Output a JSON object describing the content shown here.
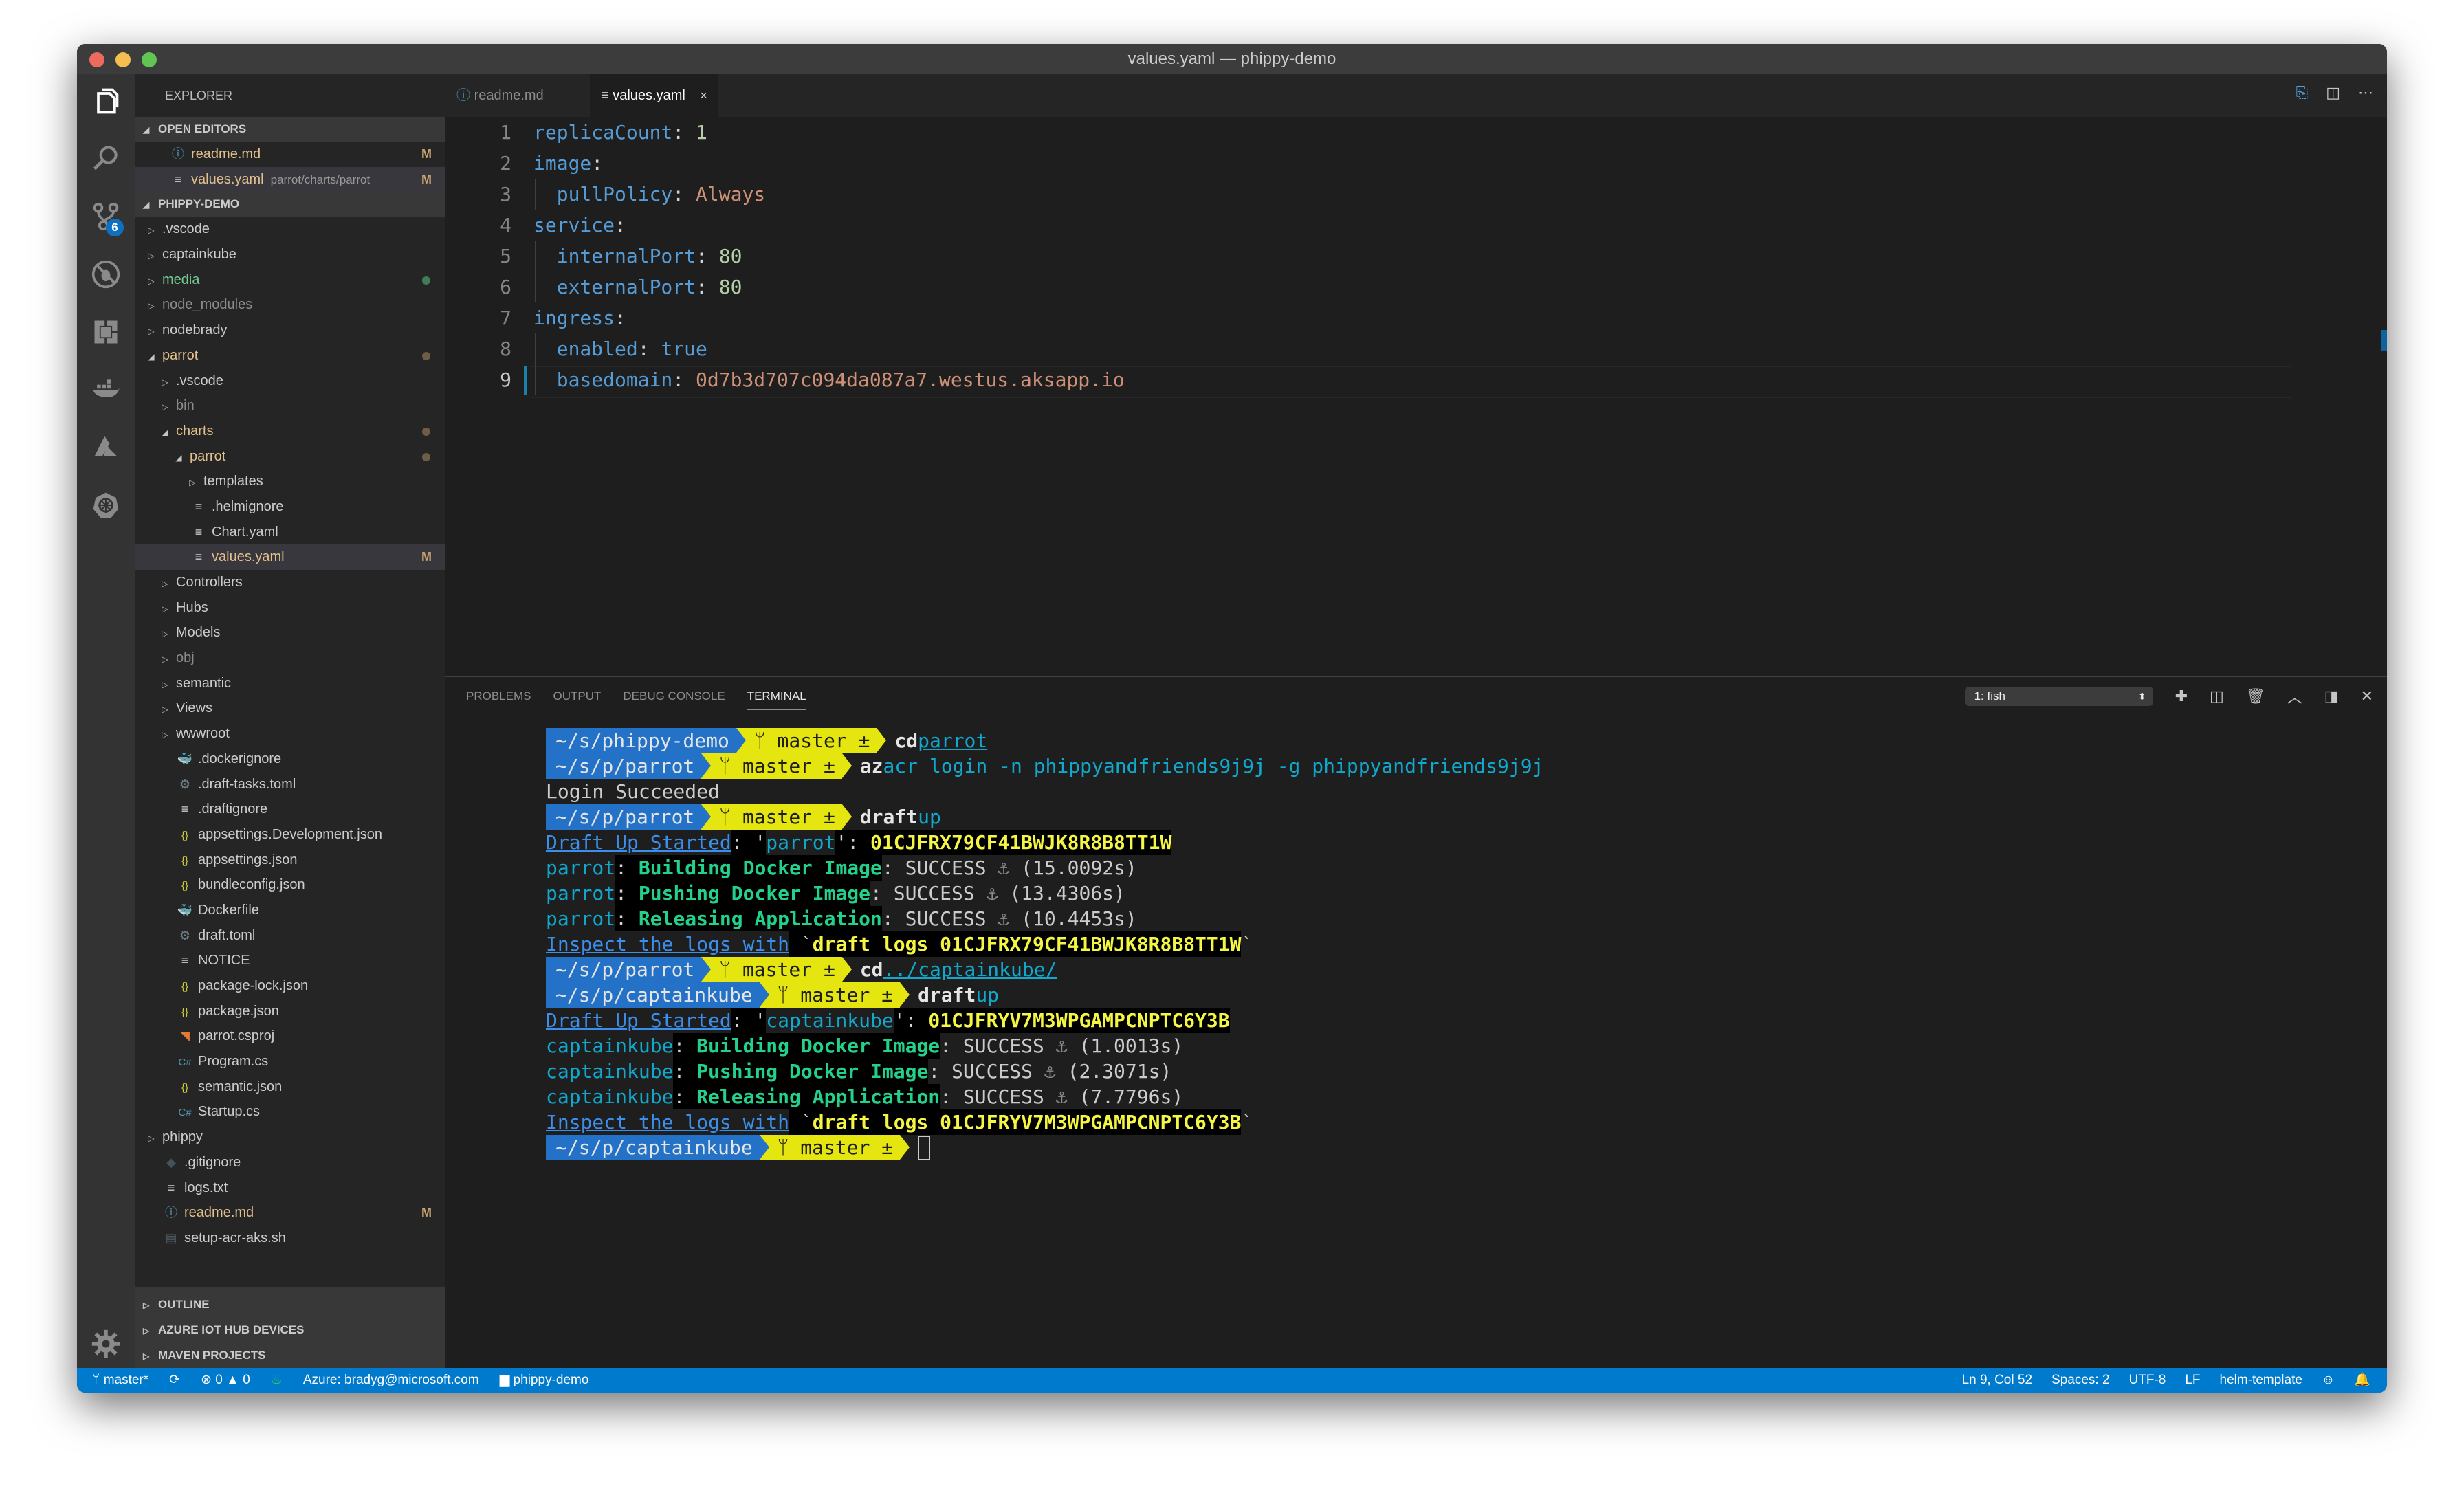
{
  "window": {
    "title": "values.yaml — phippy-demo"
  },
  "activity_bar": {
    "items": [
      {
        "name": "explorer",
        "icon": "files-icon"
      },
      {
        "name": "search",
        "icon": "search-icon"
      },
      {
        "name": "source-control",
        "icon": "source-control-icon",
        "badge": "6"
      },
      {
        "name": "debug",
        "icon": "no-bug-icon"
      },
      {
        "name": "extensions",
        "icon": "extensions-icon"
      },
      {
        "name": "docker",
        "icon": "docker-icon"
      },
      {
        "name": "azure",
        "icon": "azure-icon"
      },
      {
        "name": "kubernetes",
        "icon": "kubernetes-icon"
      }
    ],
    "settings_icon": "gear-icon"
  },
  "sidebar": {
    "header": "EXPLORER",
    "open_editors": {
      "title": "OPEN EDITORS",
      "items": [
        {
          "name": "readme.md",
          "icon": "info-icon",
          "desc": "",
          "status": "M"
        },
        {
          "name": "values.yaml",
          "icon": "lines-icon",
          "desc": "parrot/charts/parrot",
          "status": "M"
        }
      ]
    },
    "folder": {
      "title": "PHIPPY-DEMO",
      "tree": [
        {
          "label": ".vscode",
          "type": "folder",
          "depth": 0
        },
        {
          "label": "captainkube",
          "type": "folder",
          "depth": 0
        },
        {
          "label": "media",
          "type": "folder",
          "depth": 0,
          "color": "green",
          "dot": "green"
        },
        {
          "label": "node_modules",
          "type": "folder",
          "depth": 0,
          "color": "dim"
        },
        {
          "label": "nodebrady",
          "type": "folder",
          "depth": 0
        },
        {
          "label": "parrot",
          "type": "folder-open",
          "depth": 0,
          "color": "mod",
          "dot": "brown"
        },
        {
          "label": ".vscode",
          "type": "folder",
          "depth": 1
        },
        {
          "label": "bin",
          "type": "folder",
          "depth": 1,
          "color": "dim"
        },
        {
          "label": "charts",
          "type": "folder-open",
          "depth": 1,
          "color": "mod",
          "dot": "brown"
        },
        {
          "label": "parrot",
          "type": "folder-open",
          "depth": 2,
          "color": "mod",
          "dot": "brown"
        },
        {
          "label": "templates",
          "type": "folder",
          "depth": 3
        },
        {
          "label": ".helmignore",
          "type": "file",
          "icon": "≡",
          "depth": 3
        },
        {
          "label": "Chart.yaml",
          "type": "file",
          "icon": "≡",
          "depth": 3
        },
        {
          "label": "values.yaml",
          "type": "file",
          "icon": "≡",
          "depth": 3,
          "color": "mod",
          "status": "M",
          "selected": true
        },
        {
          "label": "Controllers",
          "type": "folder",
          "depth": 1
        },
        {
          "label": "Hubs",
          "type": "folder",
          "depth": 1
        },
        {
          "label": "Models",
          "type": "folder",
          "depth": 1
        },
        {
          "label": "obj",
          "type": "folder",
          "depth": 1,
          "color": "dim"
        },
        {
          "label": "semantic",
          "type": "folder",
          "depth": 1
        },
        {
          "label": "Views",
          "type": "folder",
          "depth": 1
        },
        {
          "label": "wwwroot",
          "type": "folder",
          "depth": 1
        },
        {
          "label": ".dockerignore",
          "type": "file",
          "icon": "🐳",
          "iconColor": "#4d5a5e",
          "depth": 2
        },
        {
          "label": ".draft-tasks.toml",
          "type": "file",
          "icon": "⚙",
          "iconColor": "#6d8086",
          "depth": 2
        },
        {
          "label": ".draftignore",
          "type": "file",
          "icon": "≡",
          "depth": 2
        },
        {
          "label": "appsettings.Development.json",
          "type": "file",
          "icon": "{}",
          "iconColor": "#cbcb41",
          "depth": 2
        },
        {
          "label": "appsettings.json",
          "type": "file",
          "icon": "{}",
          "iconColor": "#cbcb41",
          "depth": 2
        },
        {
          "label": "bundleconfig.json",
          "type": "file",
          "icon": "{}",
          "iconColor": "#cbcb41",
          "depth": 2
        },
        {
          "label": "Dockerfile",
          "type": "file",
          "icon": "🐳",
          "iconColor": "#519aba",
          "depth": 2
        },
        {
          "label": "draft.toml",
          "type": "file",
          "icon": "⚙",
          "iconColor": "#6d8086",
          "depth": 2
        },
        {
          "label": "NOTICE",
          "type": "file",
          "icon": "≡",
          "depth": 2
        },
        {
          "label": "package-lock.json",
          "type": "file",
          "icon": "{}",
          "iconColor": "#cbcb41",
          "depth": 2
        },
        {
          "label": "package.json",
          "type": "file",
          "icon": "{}",
          "iconColor": "#cbcb41",
          "depth": 2
        },
        {
          "label": "parrot.csproj",
          "type": "file",
          "icon": "◥",
          "iconColor": "#e37933",
          "depth": 2
        },
        {
          "label": "Program.cs",
          "type": "file",
          "icon": "C#",
          "iconColor": "#519aba",
          "depth": 2
        },
        {
          "label": "semantic.json",
          "type": "file",
          "icon": "{}",
          "iconColor": "#cbcb41",
          "depth": 2
        },
        {
          "label": "Startup.cs",
          "type": "file",
          "icon": "C#",
          "iconColor": "#519aba",
          "depth": 2
        },
        {
          "label": "phippy",
          "type": "folder",
          "depth": 0
        },
        {
          "label": ".gitignore",
          "type": "file",
          "icon": "◆",
          "iconColor": "#41535b",
          "depth": 1
        },
        {
          "label": "logs.txt",
          "type": "file",
          "icon": "≡",
          "depth": 1
        },
        {
          "label": "readme.md",
          "type": "file",
          "icon": "ⓘ",
          "iconColor": "#519aba",
          "depth": 1,
          "color": "mod",
          "status": "M"
        },
        {
          "label": "setup-acr-aks.sh",
          "type": "file",
          "icon": "▤",
          "iconColor": "#4d5a5e",
          "depth": 1
        }
      ]
    },
    "bottom_sections": [
      "OUTLINE",
      "AZURE IOT HUB DEVICES",
      "MAVEN PROJECTS"
    ]
  },
  "editor": {
    "tabs": [
      {
        "label": "readme.md",
        "icon": "ⓘ",
        "active": false
      },
      {
        "label": "values.yaml",
        "icon": "≡",
        "active": true,
        "close": "×"
      }
    ],
    "actions": [
      "open-preview-icon",
      "split-editor-icon",
      "more-icon"
    ],
    "lines": [
      {
        "n": "1",
        "indent": 0,
        "key": "replicaCount",
        "value": "1",
        "vtype": "n"
      },
      {
        "n": "2",
        "indent": 0,
        "key": "image",
        "value": "",
        "vtype": ""
      },
      {
        "n": "3",
        "indent": 1,
        "key": "pullPolicy",
        "value": "Always",
        "vtype": "s"
      },
      {
        "n": "4",
        "indent": 0,
        "key": "service",
        "value": "",
        "vtype": ""
      },
      {
        "n": "5",
        "indent": 1,
        "key": "internalPort",
        "value": "80",
        "vtype": "n"
      },
      {
        "n": "6",
        "indent": 1,
        "key": "externalPort",
        "value": "80",
        "vtype": "n"
      },
      {
        "n": "7",
        "indent": 0,
        "key": "ingress",
        "value": "",
        "vtype": ""
      },
      {
        "n": "8",
        "indent": 1,
        "key": "enabled",
        "value": "true",
        "vtype": "k"
      },
      {
        "n": "9",
        "indent": 1,
        "key": "basedomain",
        "value": "0d7b3d707c094da087a7.westus.aksapp.io",
        "vtype": "s"
      }
    ],
    "current_line": 9
  },
  "panel": {
    "tabs": [
      "PROBLEMS",
      "OUTPUT",
      "DEBUG CONSOLE",
      "TERMINAL"
    ],
    "active_tab": "TERMINAL",
    "terminal_select": "1: fish",
    "actions": [
      "plus-icon",
      "split-terminal-icon",
      "trash-icon",
      "chevron-up-icon",
      "maximize-panel-icon",
      "close-icon"
    ],
    "terminal": {
      "branch": "master ±",
      "lines": [
        {
          "kind": "prompt",
          "cwd": "~/s/phippy-demo",
          "cmd": "cd",
          "args": "parrot",
          "args_style": "cy ul"
        },
        {
          "kind": "prompt",
          "cwd": "~/s/p/parrot",
          "cmd": "az",
          "args": "acr login -n phippyandfriends9j9j -g phippyandfriends9j9j",
          "args_style": "cy"
        },
        {
          "kind": "text",
          "text": "Login Succeeded"
        },
        {
          "kind": "prompt",
          "cwd": "~/s/p/parrot",
          "cmd": "draft",
          "args": "up",
          "args_style": "cy"
        },
        {
          "kind": "started",
          "label": "Draft Up Started",
          "app": "parrot",
          "id": "01CJFRX79CF41BWJK8R8B8TT1W"
        },
        {
          "kind": "step",
          "app": "parrot",
          "step": "Building Docker Image",
          "result": "SUCCESS",
          "time": "(15.0092s)"
        },
        {
          "kind": "step",
          "app": "parrot",
          "step": "Pushing Docker Image",
          "result": "SUCCESS",
          "time": "(13.4306s)"
        },
        {
          "kind": "step",
          "app": "parrot",
          "step": "Releasing Application",
          "result": "SUCCESS",
          "time": "(10.4453s)"
        },
        {
          "kind": "inspect",
          "label": "Inspect the logs with",
          "cmd": "draft logs 01CJFRX79CF41BWJK8R8B8TT1W"
        },
        {
          "kind": "prompt",
          "cwd": "~/s/p/parrot",
          "cmd": "cd",
          "args": "../captainkube/",
          "args_style": "cy ul"
        },
        {
          "kind": "prompt",
          "cwd": "~/s/p/captainkube",
          "cmd": "draft",
          "args": "up",
          "args_style": "cy"
        },
        {
          "kind": "started",
          "label": "Draft Up Started",
          "app": "captainkube",
          "id": "01CJFRYV7M3WPGAMPCNPTC6Y3B"
        },
        {
          "kind": "step",
          "app": "captainkube",
          "step": "Building Docker Image",
          "result": "SUCCESS",
          "time": "(1.0013s)"
        },
        {
          "kind": "step",
          "app": "captainkube",
          "step": "Pushing Docker Image",
          "result": "SUCCESS",
          "time": "(2.3071s)"
        },
        {
          "kind": "step",
          "app": "captainkube",
          "step": "Releasing Application",
          "result": "SUCCESS",
          "time": "(7.7796s)"
        },
        {
          "kind": "inspect",
          "label": "Inspect the logs with",
          "cmd": "draft logs 01CJFRYV7M3WPGAMPCNPTC6Y3B"
        },
        {
          "kind": "prompt-cursor",
          "cwd": "~/s/p/captainkube"
        }
      ],
      "anchor": "⚓"
    }
  },
  "status_bar": {
    "left": [
      {
        "name": "branch",
        "icon": "branch-icon",
        "text": "master*"
      },
      {
        "name": "sync",
        "icon": "sync-icon",
        "text": ""
      },
      {
        "name": "problems",
        "icon": "error-icon",
        "text": "0",
        "warn_text": "0"
      },
      {
        "name": "flame",
        "icon": "flame-icon",
        "text": ""
      },
      {
        "name": "azure-account",
        "text": "Azure: bradyg@microsoft.com"
      },
      {
        "name": "folder",
        "icon": "folder-icon",
        "text": "phippy-demo"
      }
    ],
    "right": [
      {
        "name": "cursor-position",
        "text": "Ln 9, Col 52"
      },
      {
        "name": "indentation",
        "text": "Spaces: 2"
      },
      {
        "name": "encoding",
        "text": "UTF-8"
      },
      {
        "name": "eol",
        "text": "LF"
      },
      {
        "name": "language",
        "text": "helm-template"
      }
    ],
    "colors": {
      "background": "#007acc"
    }
  }
}
